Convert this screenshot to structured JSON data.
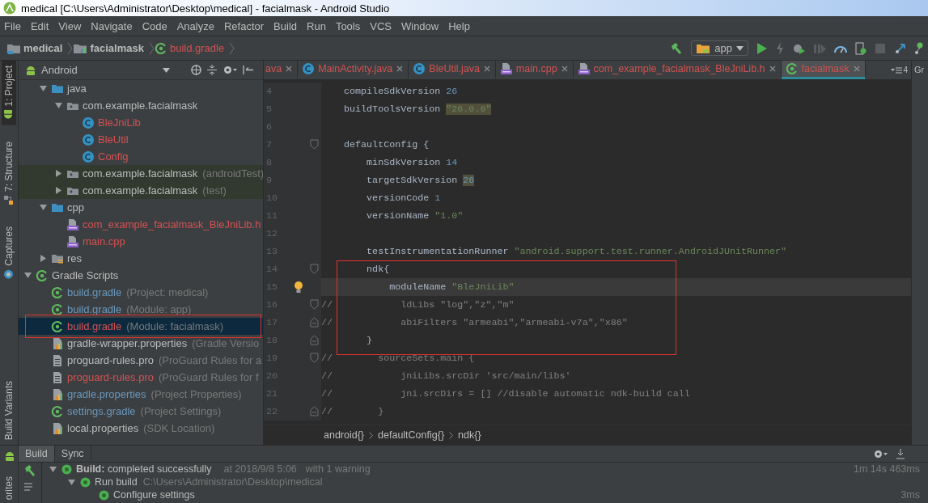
{
  "window": {
    "title": "medical [C:\\Users\\Administrator\\Desktop\\medical] - facialmask - Android Studio"
  },
  "menu": [
    "File",
    "Edit",
    "View",
    "Navigate",
    "Code",
    "Analyze",
    "Refactor",
    "Build",
    "Run",
    "Tools",
    "VCS",
    "Window",
    "Help"
  ],
  "breadcrumbs": [
    {
      "label": "medical",
      "kind": "project",
      "color": "#bbbbbb"
    },
    {
      "label": "facialmask",
      "kind": "module",
      "color": "#bbbbbb"
    },
    {
      "label": "build.gradle",
      "kind": "gradle",
      "color": "#d25252"
    }
  ],
  "run_config": {
    "label": "app"
  },
  "left_strip": {
    "top": [
      {
        "label": "1: Project",
        "selected": true
      },
      {
        "label": "7: Structure",
        "selected": false
      },
      {
        "label": "Captures",
        "selected": false
      }
    ],
    "bottom": [
      {
        "label": "Build Variants",
        "selected": false
      }
    ]
  },
  "bottom_strip": [
    {
      "label": "orites",
      "selected": false
    }
  ],
  "project": {
    "view": "Android",
    "tree": [
      {
        "children": [
          {
            "label": "java",
            "kind": "folder",
            "color": "#bbbbbb",
            "expanded": true,
            "selected": false,
            "children": [
              {
                "label": "com.example.facialmask",
                "kind": "package",
                "color": "#bbbbbb",
                "expanded": true,
                "selected": false,
                "children": [
                  {
                    "label": "BleJniLib",
                    "kind": "class",
                    "color": "#d25252",
                    "selected": false
                  },
                  {
                    "label": "BleUtil",
                    "kind": "class",
                    "color": "#d25252",
                    "selected": false
                  },
                  {
                    "label": "Config",
                    "kind": "class",
                    "color": "#d25252",
                    "selected": false
                  }
                ]
              },
              {
                "label": "com.example.facialmask",
                "detail": "(androidTest)",
                "kind": "package",
                "color": "#bbbbbb",
                "expanded": false,
                "test": true,
                "selected": false
              },
              {
                "label": "com.example.facialmask",
                "detail": "(test)",
                "kind": "package",
                "color": "#bbbbbb",
                "expanded": false,
                "test": true,
                "selected": false
              }
            ]
          },
          {
            "label": "cpp",
            "kind": "folder",
            "color": "#bbbbbb",
            "expanded": true,
            "selected": false,
            "children": [
              {
                "label": "com_example_facialmask_BleJniLib.h",
                "kind": "cpp",
                "color": "#d25252",
                "selected": false
              },
              {
                "label": "main.cpp",
                "kind": "cpp",
                "color": "#d25252",
                "selected": false
              }
            ]
          },
          {
            "label": "res",
            "kind": "resfolder",
            "color": "#bbbbbb",
            "expanded": false,
            "selected": false
          }
        ]
      },
      {
        "label": "Gradle Scripts",
        "kind": "gradle",
        "color": "#bbbbbb",
        "expanded": true,
        "selected": false,
        "children": [
          {
            "label": "build.gradle",
            "detail": "(Project: medical)",
            "kind": "gradle",
            "color": "#6897bb",
            "selected": false
          },
          {
            "label": "build.gradle",
            "detail": "(Module: app)",
            "kind": "gradle",
            "color": "#6897bb",
            "selected": false
          },
          {
            "label": "build.gradle",
            "detail": "(Module: facialmask)",
            "kind": "gradle",
            "color": "#d25252",
            "selected": true,
            "framed": true
          },
          {
            "label": "gradle-wrapper.properties",
            "detail": "(Gradle Versio",
            "kind": "props",
            "color": "#bbbbbb",
            "selected": false
          },
          {
            "label": "proguard-rules.pro",
            "detail": "(ProGuard Rules for a",
            "kind": "text",
            "color": "#bbbbbb",
            "selected": false
          },
          {
            "label": "proguard-rules.pro",
            "detail": "(ProGuard Rules for f",
            "kind": "text",
            "color": "#d25252",
            "selected": false
          },
          {
            "label": "gradle.properties",
            "detail": "(Project Properties)",
            "kind": "props",
            "color": "#6897bb",
            "selected": false
          },
          {
            "label": "settings.gradle",
            "detail": "(Project Settings)",
            "kind": "gradle",
            "color": "#6897bb",
            "selected": false
          },
          {
            "label": "local.properties",
            "detail": "(SDK Location)",
            "kind": "props",
            "color": "#bbbbbb",
            "selected": false
          }
        ]
      }
    ]
  },
  "editor": {
    "tabs": [
      {
        "label": "ava",
        "kind": "none",
        "color": "#d25252",
        "selected": false
      },
      {
        "label": "MainActivity.java",
        "kind": "class",
        "color": "#d25252",
        "selected": false
      },
      {
        "label": "BleUtil.java",
        "kind": "class",
        "color": "#d25252",
        "selected": false
      },
      {
        "label": "main.cpp",
        "kind": "cpp",
        "color": "#d25252",
        "selected": false
      },
      {
        "label": "com_example_facialmask_BleJniLib.h",
        "kind": "cpp",
        "color": "#d25252",
        "selected": false
      },
      {
        "label": "facialmask",
        "kind": "gradle",
        "color": "#d25252",
        "selected": true
      }
    ],
    "hidden_tab_count": "4",
    "lines": [
      {
        "number": "4",
        "tokens": [
          {
            "t": "    compileSdkVersion ",
            "kind": "plain"
          },
          {
            "t": "26",
            "kind": "number"
          }
        ]
      },
      {
        "number": "5",
        "tokens": [
          {
            "t": "    buildToolsVersion ",
            "kind": "plain"
          },
          {
            "t": "\"26.0.0\"",
            "kind": "string",
            "warn": true
          }
        ]
      },
      {
        "number": "6"
      },
      {
        "number": "7",
        "kind": "foldstart",
        "tokens": [
          {
            "t": "    defaultConfig {",
            "kind": "plain"
          }
        ]
      },
      {
        "number": "8",
        "tokens": [
          {
            "t": "        minSdkVersion ",
            "kind": "plain"
          },
          {
            "t": "14",
            "kind": "number"
          }
        ]
      },
      {
        "number": "9",
        "tokens": [
          {
            "t": "        targetSdkVersion ",
            "kind": "plain"
          },
          {
            "t": "26",
            "kind": "number",
            "warn": true
          }
        ]
      },
      {
        "number": "10",
        "tokens": [
          {
            "t": "        versionCode ",
            "kind": "plain"
          },
          {
            "t": "1",
            "kind": "number"
          }
        ]
      },
      {
        "number": "11",
        "tokens": [
          {
            "t": "        versionName ",
            "kind": "plain"
          },
          {
            "t": "\"1.0\"",
            "kind": "string"
          }
        ]
      },
      {
        "number": "12"
      },
      {
        "number": "13",
        "tokens": [
          {
            "t": "        testInstrumentationRunner ",
            "kind": "plain"
          },
          {
            "t": "\"android.support.test.runner.AndroidJUnitRunner\"",
            "kind": "string"
          }
        ]
      },
      {
        "number": "14",
        "kind": "foldstart",
        "framed": true,
        "tokens": [
          {
            "t": "        ndk{",
            "kind": "plain"
          }
        ]
      },
      {
        "number": "15",
        "current": true,
        "bulb": true,
        "framed": true,
        "tokens": [
          {
            "t": "            moduleName ",
            "kind": "plain"
          },
          {
            "t": "\"BleJniLib\"",
            "kind": "string"
          }
        ]
      },
      {
        "number": "16",
        "kind": "foldstart",
        "framed": true,
        "tokens": [
          {
            "t": "//            ldLibs \"log\",\"z\",\"m\"",
            "kind": "comment"
          }
        ]
      },
      {
        "number": "17",
        "kind": "foldend",
        "framed": true,
        "tokens": [
          {
            "t": "//            abiFilters \"armeabi\",\"armeabi-v7a\",\"x86\"",
            "kind": "comment"
          }
        ]
      },
      {
        "number": "18",
        "kind": "foldend",
        "framed": true,
        "tokens": [
          {
            "t": "        }",
            "kind": "plain"
          }
        ]
      },
      {
        "number": "19",
        "kind": "foldstart",
        "tokens": [
          {
            "t": "//        sourceSets.main {",
            "kind": "comment"
          }
        ]
      },
      {
        "number": "20",
        "tokens": [
          {
            "t": "//            jniLibs.srcDir 'src/main/libs'",
            "kind": "comment"
          }
        ]
      },
      {
        "number": "21",
        "tokens": [
          {
            "t": "//            jni.srcDirs = [] //disable automatic ndk-build call",
            "kind": "comment"
          }
        ]
      },
      {
        "number": "22",
        "kind": "foldend",
        "tokens": [
          {
            "t": "//        }",
            "kind": "comment"
          }
        ]
      }
    ],
    "breadcrumb": [
      "android{}",
      "defaultConfig{}",
      "ndk{}"
    ]
  },
  "right_panel": {
    "label": "Gr"
  },
  "build": {
    "tabs": [
      {
        "label": "Build",
        "selected": true
      },
      {
        "label": "Sync",
        "selected": false
      }
    ],
    "tree": [
      {
        "label": "**Build:** completed successfully",
        "time": "at 2018/9/8 5:06",
        "note": "with 1 warning",
        "duration": "1m 14s 463ms",
        "expanded": true,
        "children": [
          {
            "label": "Run build",
            "detail": "C:\\Users\\Administrator\\Desktop\\medical",
            "expanded": true,
            "children": [
              {
                "label": "Configure settings",
                "duration": "3ms"
              }
            ]
          }
        ]
      }
    ]
  }
}
